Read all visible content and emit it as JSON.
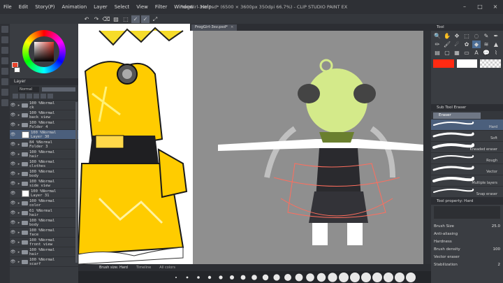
{
  "menu": [
    "File",
    "Edit",
    "Story(P)",
    "Animation",
    "Layer",
    "Select",
    "View",
    "Filter",
    "Window",
    "Help"
  ],
  "window_title": "FrogGirl-3sv.psd* (6500 × 3600px 350dpi 66.7%) - CLIP STUDIO PAINT EX",
  "window_controls": {
    "minimize": "–",
    "maximize": "□",
    "close": "×"
  },
  "doc_tab": "FrogGirl-3sv.psd*",
  "layer_panel": {
    "title": "Layer",
    "blend_mode": "Normal",
    "layers": [
      {
        "name": "100 %Normal\nck",
        "kind": "folder",
        "selected": false
      },
      {
        "name": "100 %Normal\nback view",
        "kind": "folder",
        "selected": false
      },
      {
        "name": "100 %Normal\nFolder 4",
        "kind": "folder",
        "selected": false
      },
      {
        "name": "100 %Normal\nLayer 30",
        "kind": "layer",
        "selected": true
      },
      {
        "name": "84 %Normal\nFolder 3",
        "kind": "folder",
        "selected": false
      },
      {
        "name": "100 %Normal\nhair",
        "kind": "folder",
        "selected": false
      },
      {
        "name": "100 %Normal\nclothes",
        "kind": "folder",
        "selected": false
      },
      {
        "name": "100 %Normal\nbody",
        "kind": "folder",
        "selected": false
      },
      {
        "name": "100 %Normal\nside view",
        "kind": "folder",
        "selected": false
      },
      {
        "name": "100 %Normal\nLayer 31",
        "kind": "layer",
        "selected": false
      },
      {
        "name": "100 %Normal\ncolor",
        "kind": "folder",
        "selected": false
      },
      {
        "name": "61 %Normal\nhair",
        "kind": "folder",
        "selected": false
      },
      {
        "name": "100 %Normal\nbody",
        "kind": "folder",
        "selected": false
      },
      {
        "name": "100 %Normal\nface",
        "kind": "folder",
        "selected": false
      },
      {
        "name": "100 %Normal\nfront view",
        "kind": "folder",
        "selected": false
      },
      {
        "name": "100 %Normal\nhair",
        "kind": "folder",
        "selected": false
      },
      {
        "name": "100 %Normal\nscarf",
        "kind": "folder",
        "selected": false
      }
    ]
  },
  "status_bar": {
    "brush_name": "Brush size: Hard",
    "item2": "Timeline",
    "item3": "All colors"
  },
  "tool_panel": {
    "title": "Tool",
    "subtool_title": "Sub Tool Eraser",
    "subtool_tab": "Eraser",
    "brushes": [
      {
        "label": "Hard",
        "selected": true
      },
      {
        "label": "Soft",
        "selected": false
      },
      {
        "label": "Kneaded eraser",
        "selected": false
      },
      {
        "label": "Rough",
        "selected": false
      },
      {
        "label": "Vector",
        "selected": false
      },
      {
        "label": "Multiple layers",
        "selected": false
      },
      {
        "label": "Snap eraser",
        "selected": false
      }
    ],
    "property_title": "Tool property: Hard",
    "properties": [
      {
        "label": "Brush Size",
        "value": "25.0"
      },
      {
        "label": "Anti-aliasing",
        "value": ""
      },
      {
        "label": "Hardness",
        "value": ""
      },
      {
        "label": "Brush density",
        "value": "100"
      },
      {
        "label": "Vector eraser",
        "value": ""
      },
      {
        "label": "Stabilization",
        "value": "2"
      }
    ]
  },
  "colors": {
    "main": "#e8432b",
    "sub": "#ffffff",
    "accent": "#4d6e96"
  }
}
